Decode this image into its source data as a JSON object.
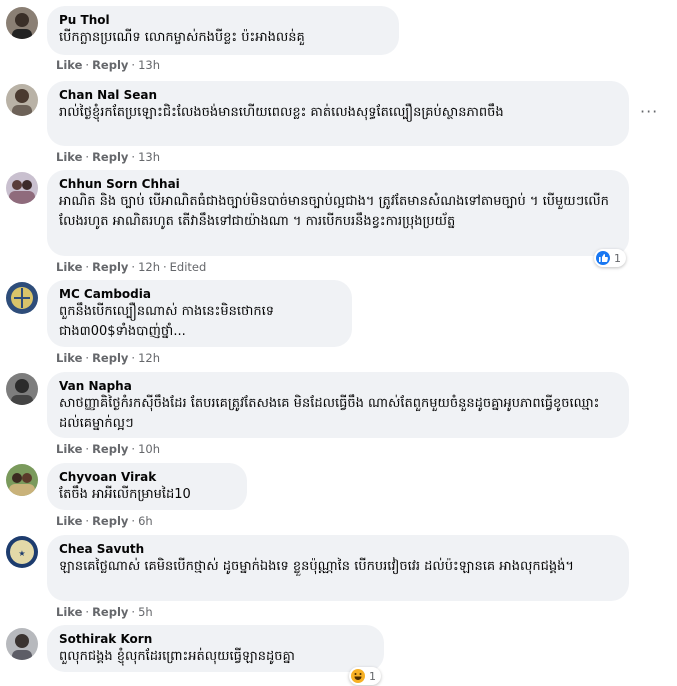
{
  "labels": {
    "like": "Like",
    "reply": "Reply"
  },
  "more_options": "···",
  "comments": [
    {
      "name": "Pu Thol",
      "text": "បើកក្លានប្រណើទ លោកម្ចាស់កងបីខ្លះ ប៉ះអាងលន់គួ",
      "time": "13h"
    },
    {
      "name": "Chan Nal Sean",
      "text": "រាល់ថ្ងៃខ្ញុំរកតែប្រឡោះជិះលែងចង់មានហើយពេលខ្លះ គាត់លេងសុទ្ធតែល្បឿនគ្រប់ស្ថានភាពចឹង",
      "time": "13h"
    },
    {
      "name": "Chhun Sorn Chhai",
      "text": "អាណិត និង ច្បាប់ បើអាណិតធំជាងច្បាប់មិនបាច់មានច្បាប់ល្អជាង។ ត្រូវតែមានសំណងទៅតាមច្បាប់ ។ បើមួយៗលើកលែងរហូត អាណិតរហូត តើវានឹងទៅជាយ៉ាងណា ។ ការបើកបរនឹងខ្វះការប្រុងប្រយ័ត្ន",
      "time": "12h",
      "edited": "Edited",
      "reaction_count": "1"
    },
    {
      "name": "MC Cambodia",
      "text": "ពួកនឹងបើកល្បឿនណាស់ កាងនេះមិនថោកទេជាង៣00$ទាំងបាញ់ថ្នាំ...",
      "time": "12h"
    },
    {
      "name": "Van Napha",
      "text": "សាថញ្ញាគិថ្ងៃកំរកស៊ីចឹងដែរ តែបរគេត្រូវតែសងគេ មិនដែលធ្វើចឹង ណាស់តែពួកមួយចំនួនដូចគ្នាអូបភាពធ្វើខូចឈ្មោះដល់គេម្នាក់ល្អៗ",
      "time": "10h"
    },
    {
      "name": "Chyvoan Virak",
      "text": "តែចឹង អាអីលើកម្រាមដៃ10",
      "time": "6h"
    },
    {
      "name": "Chea Savuth",
      "text": "ឡានគេថ្លៃណាស់ គេមិនបើកថ្មាស់ ដូចម្នាក់ឯងទេ ខ្លួនប៉ុណ្ណានៃ បើកបរវៀចវេរ ដល់ប៉ះឡានគេ អាងលុកជង្គង់។",
      "time": "5h"
    },
    {
      "name": "Sothirak Korn",
      "text": "ពួលុកជង្គង ខ្ញុំលុកដែរព្រោះអត់លុយធ្វើឡានដូចគ្នា",
      "time": "",
      "reaction_count": "1"
    }
  ],
  "colors": {
    "bubble": "#f0f2f5",
    "meta": "#65676b",
    "like_reaction": "#1877f2",
    "haha_reaction": "#f7b125"
  }
}
